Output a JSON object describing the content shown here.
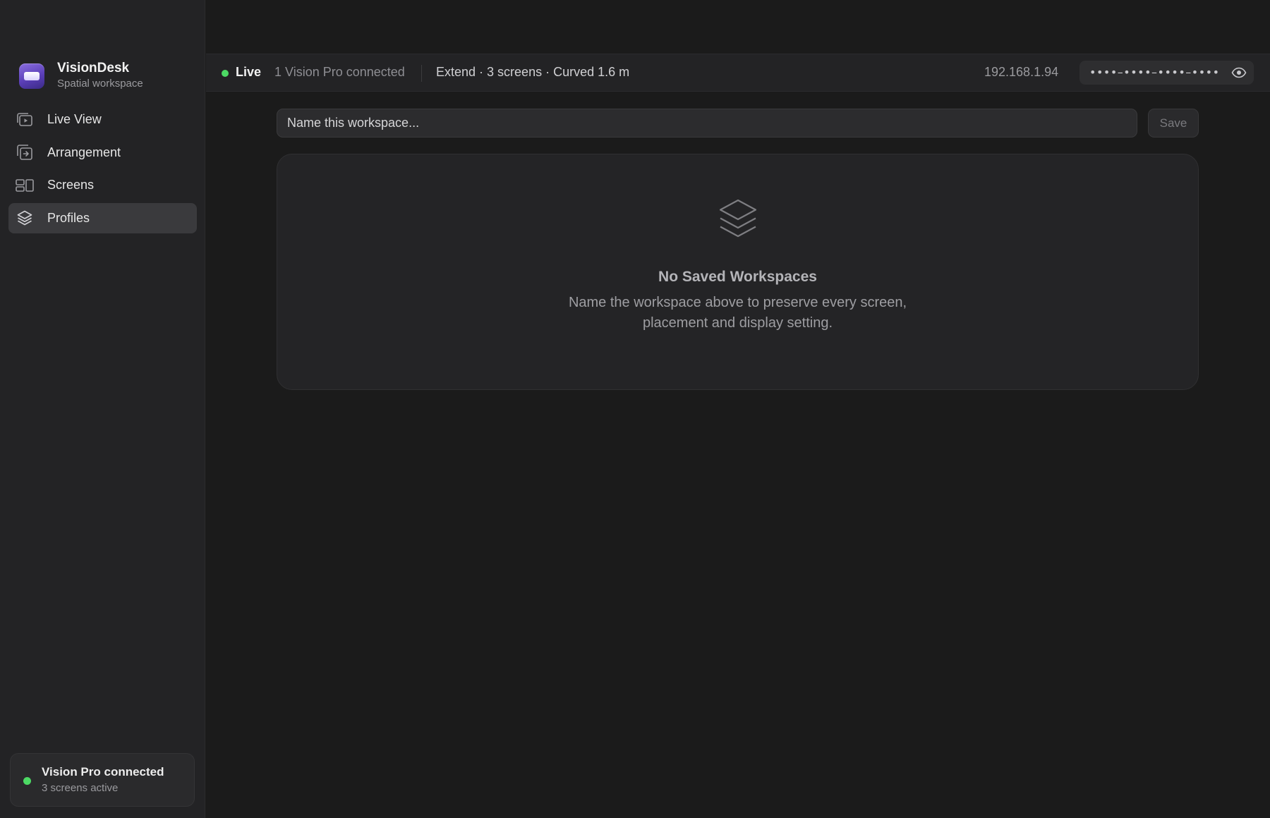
{
  "app": {
    "name": "VisionDesk",
    "subtitle": "Spatial workspace"
  },
  "sidebar": {
    "items": [
      {
        "label": "Live View",
        "icon": "live-view-icon",
        "active": false
      },
      {
        "label": "Arrangement",
        "icon": "arrangement-icon",
        "active": false
      },
      {
        "label": "Screens",
        "icon": "screens-icon",
        "active": false
      },
      {
        "label": "Profiles",
        "icon": "layers-icon",
        "active": true
      }
    ],
    "status": {
      "title": "Vision Pro connected",
      "subtitle": "3 screens active",
      "color": "#4cd964"
    }
  },
  "topbar": {
    "live_label": "Live",
    "connected_text": "1 Vision Pro connected",
    "arrangement_summary": "Extend · 3 screens · Curved 1.6 m",
    "ip_address": "192.168.1.94",
    "pairing_code_masked": "••••–••••–••••–••••",
    "reveal_icon": "eye-icon"
  },
  "workspace": {
    "name_placeholder": "Name this workspace...",
    "name_value": "",
    "save_label": "Save"
  },
  "empty_state": {
    "icon": "layers-icon",
    "title": "No Saved Workspaces",
    "description": "Name the workspace above to preserve every screen, placement and display setting."
  },
  "colors": {
    "accent_live": "#4cd964",
    "brand_purple": "#6a4fc8"
  }
}
